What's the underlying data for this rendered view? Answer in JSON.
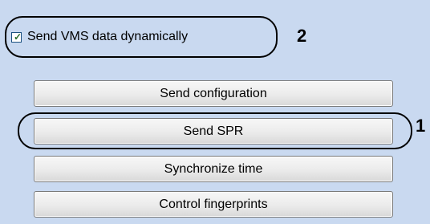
{
  "checkbox": {
    "label": "Send VMS data dynamically",
    "checked": true
  },
  "buttons": [
    {
      "label": "Send configuration"
    },
    {
      "label": "Send SPR"
    },
    {
      "label": "Synchronize time"
    },
    {
      "label": "Control fingerprints"
    }
  ],
  "callouts": {
    "checkbox": "2",
    "send_spr": "1"
  }
}
